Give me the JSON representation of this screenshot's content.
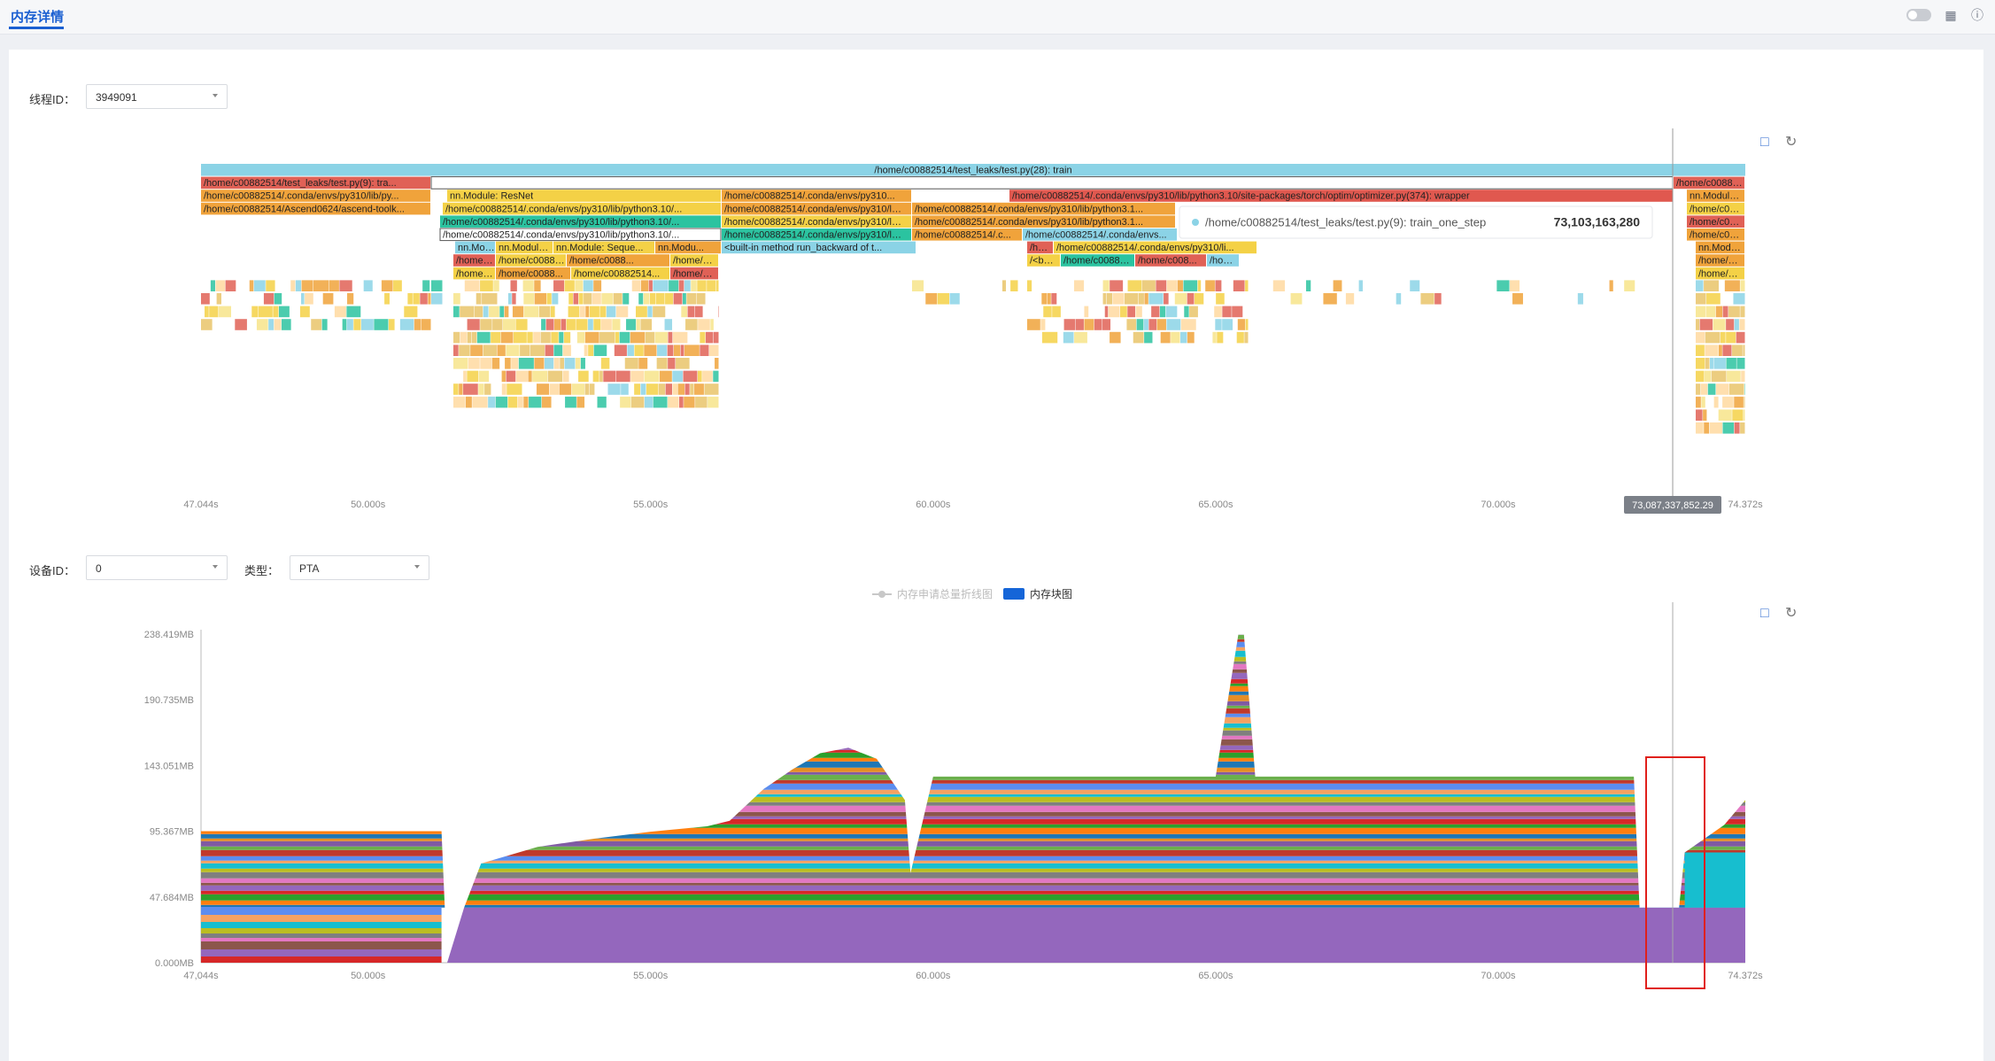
{
  "tabs": [
    {
      "label": "内存详情",
      "active": true
    }
  ],
  "thread": {
    "label": "线程ID：",
    "value": "3949091"
  },
  "device": {
    "label": "设备ID：",
    "value": "0"
  },
  "type": {
    "label": "类型：",
    "value": "PTA"
  },
  "flame": {
    "root": "/home/c00882514/test_leaks/test.py(28): train",
    "row2": [
      {
        "text": "/home/c00882514/test_leaks/test.py(9): tra...",
        "color": "#e06156"
      },
      {
        "text": "",
        "color": "#ffffff"
      },
      {
        "text": "/home/c0088...",
        "color": "#e06156"
      }
    ],
    "row3": [
      {
        "text": "/home/c00882514/.conda/envs/py310/lib/py...",
        "color": "#f0a33b"
      },
      {
        "text": "nn.Module: ResNet",
        "color": "#f4d146"
      },
      {
        "text": "/home/c00882514/.conda/envs/py310...",
        "color": "#f0a33b"
      },
      {
        "text": "/home/c00882514/.conda/envs/py310/lib/python3.10/site-packages/torch/optim/optimizer.py(374): wrapper",
        "color": "#e0584f"
      },
      {
        "text": "nn.Modul...",
        "color": "#f0a33b"
      }
    ],
    "row4": [
      {
        "text": "/home/c00882514/Ascend0624/ascend-toolk...",
        "color": "#f0a33b"
      },
      {
        "text": "/home/c00882514/.conda/envs/py310/lib/python3.10/...",
        "color": "#f4d146"
      },
      {
        "text": "/home/c00882514/.conda/envs/py310/lib/python3.10/...",
        "color": "#f0a33b"
      },
      {
        "text": "/home/c00882514/.conda/envs/py310/lib/python3.1...",
        "color": "#f0a33b"
      },
      {
        "text": "/home/c0...",
        "color": "#f4d146"
      }
    ],
    "row5": [
      {
        "text": "/home/c00882514/.conda/envs/py310/lib/python3.10/...",
        "color": "#2bc3a0"
      },
      {
        "text": "/home/c00882514/.conda/envs/py310/lib/python3.10/...",
        "color": "#f4d146"
      },
      {
        "text": "/home/c00882514/.conda/envs/py310/lib/python3.1...",
        "color": "#f0a33b"
      },
      {
        "text": "/home/c0...",
        "color": "#e06156"
      }
    ],
    "row6": [
      {
        "text": "/home/c00882514/.conda/envs/py310/lib/python3.10/...",
        "color": "#ffffff"
      },
      {
        "text": "/home/c00882514/.conda/envs/py310/lib/python3.10/...",
        "color": "#2bc3a0"
      },
      {
        "text": "/home/c00882514/.c...",
        "color": "#f0a33b"
      },
      {
        "text": "/home/c00882514/.conda/envs...",
        "color": "#8bd3e6"
      },
      {
        "text": "/home/c0...",
        "color": "#f0a33b"
      }
    ],
    "row7": [
      {
        "text": "nn.Mo...",
        "color": "#8bd3e6"
      },
      {
        "text": "nn.Module: Se...",
        "color": "#f4d146"
      },
      {
        "text": "nn.Module: Seque...",
        "color": "#f4d146"
      },
      {
        "text": "nn.Modu...",
        "color": "#f0a33b"
      },
      {
        "text": "<built-in method run_backward of t...",
        "color": "#8bd3e6"
      },
      {
        "text": "/h...",
        "color": "#e06156"
      },
      {
        "text": "/home/c00882514/.conda/envs/py310/li...",
        "color": "#f4d146"
      },
      {
        "text": "nn.Mod...",
        "color": "#f0a33b"
      }
    ],
    "row8": [
      {
        "text": "/home/...",
        "color": "#e06156"
      },
      {
        "text": "/home/c0088...",
        "color": "#f4d146"
      },
      {
        "text": "/home/c0088...",
        "color": "#f0a33b"
      },
      {
        "text": "/home/c...",
        "color": "#f4d146"
      },
      {
        "text": "/<b...",
        "color": "#f4d146"
      },
      {
        "text": "/home/c0088...",
        "color": "#2bc3a0"
      },
      {
        "text": "/home/c008...",
        "color": "#e06156"
      },
      {
        "text": "/ho...",
        "color": "#8bd3e6"
      },
      {
        "text": "/home/...",
        "color": "#f0a33b"
      }
    ],
    "row9": [
      {
        "text": "/home/...",
        "color": "#f4d146"
      },
      {
        "text": "/home/c0088...",
        "color": "#f0a33b"
      },
      {
        "text": "/home/c00882514...",
        "color": "#f4d146"
      },
      {
        "text": "/home/c...",
        "color": "#e06156"
      },
      {
        "text": "/home/...",
        "color": "#f4d146"
      }
    ],
    "tooltip": {
      "label": "/home/c00882514/test_leaks/test.py(9): train_one_step",
      "value": "73,103,163,280"
    },
    "cursor_label": "73,087,337,852.29",
    "x_ticks": [
      {
        "label": "47.044s",
        "t": 47.044
      },
      {
        "label": "50.000s",
        "t": 50.0
      },
      {
        "label": "55.000s",
        "t": 55.0
      },
      {
        "label": "60.000s",
        "t": 60.0
      },
      {
        "label": "65.000s",
        "t": 65.0
      },
      {
        "label": "70.000s",
        "t": 70.0
      },
      {
        "label": "74.372s",
        "t": 74.372
      }
    ]
  },
  "legend": [
    {
      "label": "内存申请总量折线图",
      "color": "#c8c8c8",
      "active": false
    },
    {
      "label": "内存块图",
      "color": "#1565d8",
      "active": true
    }
  ],
  "chart_data": {
    "type": "area",
    "title": "",
    "xlabel": "",
    "ylabel": "",
    "x_ticks": [
      "47,044s",
      "50.000s",
      "55.000s",
      "60.000s",
      "65.000s",
      "70.000s",
      "74.372s"
    ],
    "y_ticks": [
      "0.000MB",
      "47.684MB",
      "95.367MB",
      "143.051MB",
      "190.735MB",
      "238.419MB"
    ],
    "xlim": [
      47.044,
      74.372
    ],
    "ylim": [
      0,
      238.419
    ],
    "series": [
      {
        "x": [
          47.044,
          51.3,
          51.4,
          51.7,
          52,
          53,
          54,
          55,
          56,
          56.4,
          57,
          57.5,
          58,
          58.5,
          59,
          59.5,
          59.6,
          60,
          65,
          65.4,
          65.5,
          65.7,
          65.8,
          70,
          72.4,
          72.5,
          72.8,
          73.2,
          73.3,
          74.0,
          74.372
        ],
        "y": [
          95.4,
          95.4,
          0,
          40,
          72,
          84,
          90,
          95,
          99,
          103,
          126,
          140,
          152,
          156,
          148,
          118,
          65,
          135,
          135,
          238,
          238,
          135,
          135,
          135,
          135,
          40,
          40,
          40,
          80,
          100,
          118
        ]
      }
    ]
  }
}
